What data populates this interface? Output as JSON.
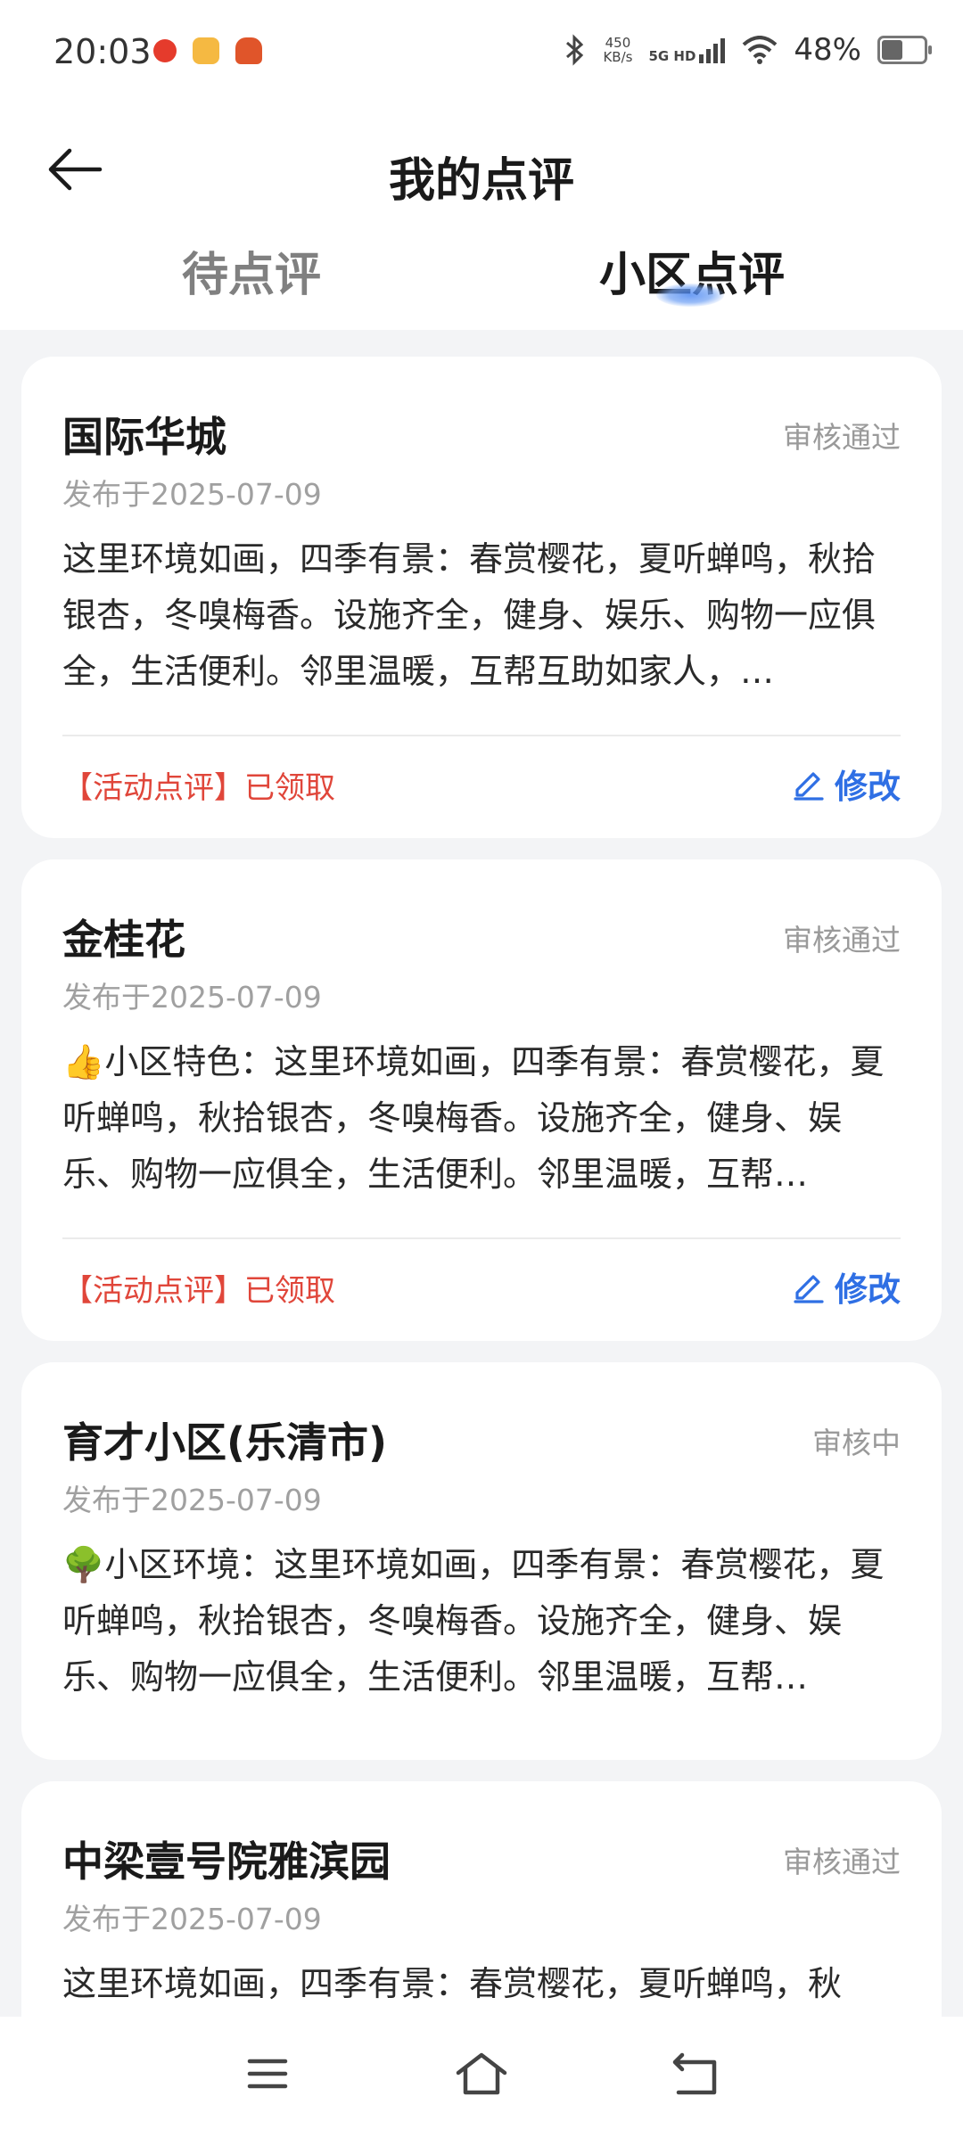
{
  "status_bar": {
    "time": "20:03",
    "net_speed_value": "450",
    "net_speed_unit": "KB/s",
    "network_label": "5G HD",
    "battery": "48%"
  },
  "header": {
    "title": "我的点评",
    "tabs": [
      {
        "label": "待点评",
        "active": false
      },
      {
        "label": "小区点评",
        "active": true
      }
    ]
  },
  "reviews": [
    {
      "name": "国际华城",
      "status": "审核通过",
      "date": "发布于2025-07-09",
      "text": "这里环境如画，四季有景：春赏樱花，夏听蝉鸣，秋拾银杏，冬嗅梅香。设施齐全，健身、娱乐、购物一应俱全，生活便利。邻里温暖，互帮互助如家人，…",
      "activity": "【活动点评】已领取",
      "edit_label": "修改"
    },
    {
      "name": "金桂花",
      "status": "审核通过",
      "date": "发布于2025-07-09",
      "text": "👍小区特色：这里环境如画，四季有景：春赏樱花，夏听蝉鸣，秋拾银杏，冬嗅梅香。设施齐全，健身、娱乐、购物一应俱全，生活便利。邻里温暖，互帮…",
      "activity": "【活动点评】已领取",
      "edit_label": "修改"
    },
    {
      "name": "育才小区(乐清市)",
      "status": "审核中",
      "date": "发布于2025-07-09",
      "text": "🌳小区环境：这里环境如画，四季有景：春赏樱花，夏听蝉鸣，秋拾银杏，冬嗅梅香。设施齐全，健身、娱乐、购物一应俱全，生活便利。邻里温暖，互帮…"
    },
    {
      "name": "中梁壹号院雅滨园",
      "status": "审核通过",
      "date": "发布于2025-07-09",
      "text": "这里环境如画，四季有景：春赏樱花，夏听蝉鸣，秋"
    }
  ],
  "colors": {
    "accent_blue": "#2f6fe4",
    "activity_red": "#e0463a",
    "page_bg": "#f3f4f6"
  }
}
